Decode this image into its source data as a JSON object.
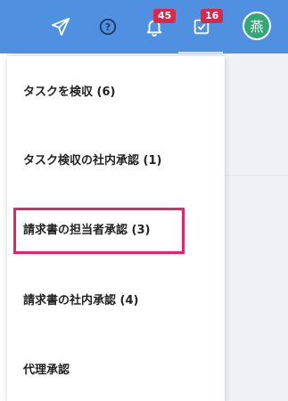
{
  "header": {
    "notification_count": "45",
    "inbox_count": "16",
    "avatar_initial": "燕",
    "icons": [
      "send-icon",
      "help-icon",
      "bell-icon",
      "inbox-check-icon"
    ]
  },
  "menu": {
    "items": [
      {
        "label": "タスクを検収 (6)"
      },
      {
        "label": "タスク検収の社内承認 (1)"
      },
      {
        "label": "請求書の担当者承認 (3)"
      },
      {
        "label": "請求書の社内承認 (4)"
      },
      {
        "label": "代理承認"
      }
    ],
    "highlighted_index": 2
  },
  "colors": {
    "topbar": "#4f90e0",
    "badge": "#d9284a",
    "avatar": "#35a676",
    "highlight": "#e8226b"
  }
}
